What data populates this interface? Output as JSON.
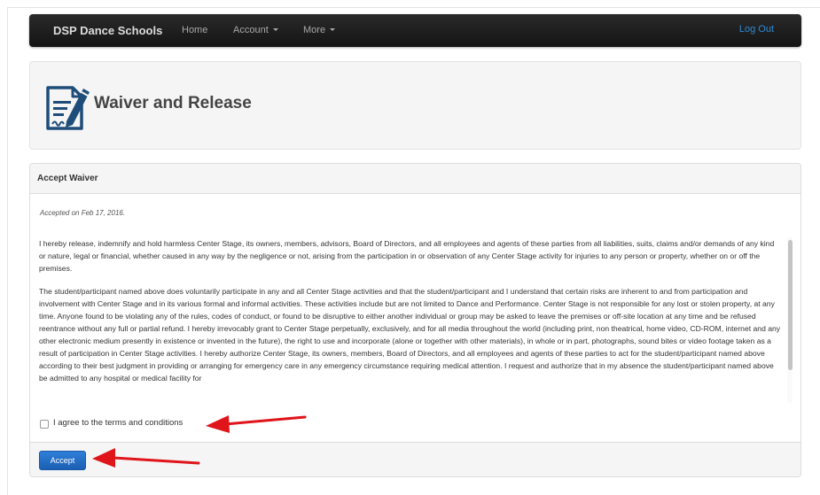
{
  "navbar": {
    "brand": "DSP Dance Schools",
    "links": [
      "Home",
      "Account",
      "More"
    ],
    "logout": "Log Out"
  },
  "header": {
    "title": "Waiver and Release",
    "icon": "document-signature-icon"
  },
  "waiver": {
    "heading": "Accept Waiver",
    "accepted_on": "Accepted on Feb 17, 2016.",
    "paragraphs": [
      "I hereby release, indemnify and hold harmless Center Stage, its owners, members, advisors, Board of Directors, and all employees and agents of these parties from all liabilities, suits, claims and/or demands of any kind or nature, legal or financial, whether caused in any way by the negligence or not, arising from the participation in or observation of any Center Stage activity for injuries to any person or property, whether on or off the premises.",
      "The student/participant named above does voluntarily participate in any and all Center Stage activities and that the student/participant and I understand that certain risks are inherent to and from participation and involvement with Center Stage and in its various formal and informal activities. These activities include but are not limited to Dance and Performance. Center Stage is not responsible for any lost or stolen property, at any time. Anyone found to be violating any of the rules, codes of conduct, or found to be disruptive to either another individual or group may be asked to leave the premises or off-site location at any time and be refused reentrance without any full or partial refund. I hereby irrevocably grant to Center Stage perpetually, exclusively, and for all media throughout the world (including print, non theatrical, home video, CD-ROM, internet and any other electronic medium presently in existence or invented in the future), the right to use and incorporate (alone or together with other materials), in whole or in part, photographs, sound bites or video footage taken as a result of participation in Center Stage activities. I hereby authorize Center Stage, its owners, members, Board of Directors, and all employees and agents of these parties to act for the student/participant named above according to their best judgment in providing or arranging for emergency care in any emergency circumstance requiring medical attention. I request and authorize that in my absence the student/participant named above be admitted to any hospital or medical facility for"
    ],
    "agree_label": "I agree to the terms and conditions",
    "accept_button": "Accept"
  },
  "colors": {
    "navbar": "#1f1f1f",
    "logout_link": "#2d8cd6",
    "accept_button": "#2570c8",
    "arrow": "#e0141b",
    "icon": "#1f4d7a"
  }
}
